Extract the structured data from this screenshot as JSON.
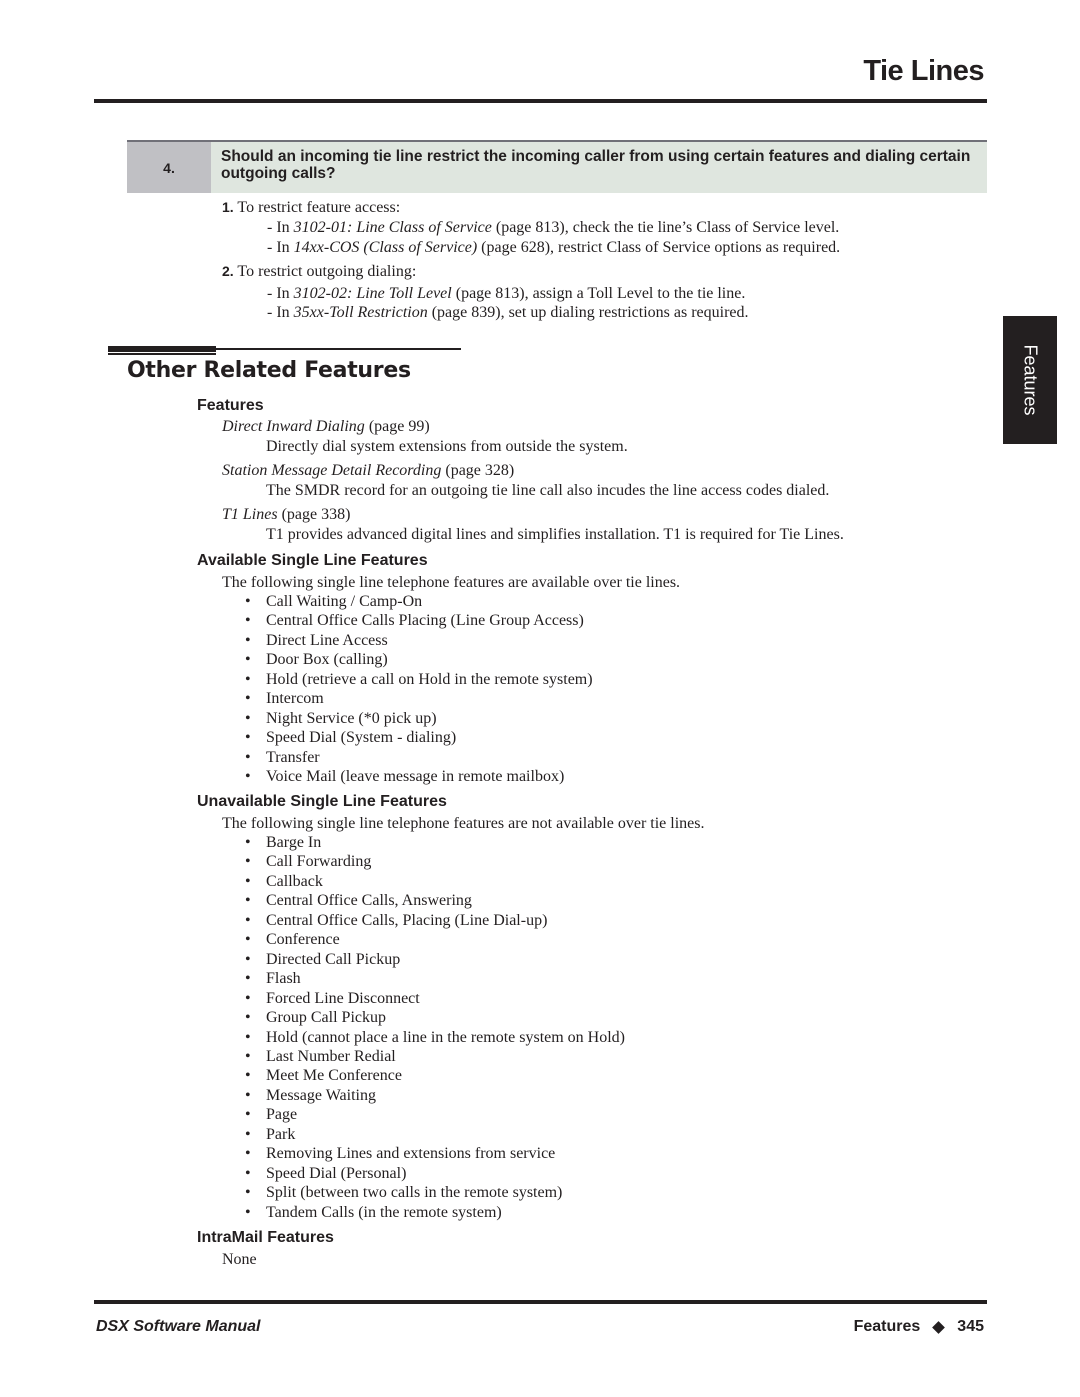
{
  "header": {
    "title": "Tie Lines"
  },
  "side_tab": {
    "label": "Features"
  },
  "question": {
    "number": "4.",
    "text": "Should an incoming tie line restrict the incoming caller from using certain features and dialing certain outgoing calls?"
  },
  "steps": [
    {
      "number": "1.",
      "text": "To restrict feature access:",
      "items": [
        {
          "prefix": "In ",
          "link": "3102-01: Line Class of Service",
          "suffix": " (page 813), check the tie line’s Class of Service level."
        },
        {
          "prefix": "In ",
          "link": "14xx-COS (Class of Service)",
          "suffix": " (page 628), restrict Class of Service options as required."
        }
      ]
    },
    {
      "number": "2.",
      "text": "To restrict outgoing dialing:",
      "items": [
        {
          "prefix": "In ",
          "link": "3102-02: Line Toll Level",
          "suffix": " (page 813), assign a Toll Level to the tie line."
        },
        {
          "prefix": "In ",
          "link": "35xx-Toll Restriction",
          "suffix": " (page 839), set up dialing restrictions as required."
        }
      ]
    }
  ],
  "related": {
    "title": "Other Related Features",
    "features_heading": "Features",
    "features": [
      {
        "link": "Direct Inward Dialing",
        "page": " (page 99)",
        "desc": "Directly dial system extensions from outside the system."
      },
      {
        "link": "Station Message Detail Recording",
        "page": " (page 328)",
        "desc": "The SMDR record for an outgoing tie line call also incudes the line access codes dialed."
      },
      {
        "link": "T1 Lines",
        "page": " (page 338)",
        "desc": "T1 provides advanced digital lines and simplifies installation. T1 is required for Tie Lines."
      }
    ],
    "available": {
      "heading": "Available Single Line Features",
      "intro": "The following single line telephone features are available over tie lines.",
      "items": [
        "Call Waiting / Camp-On",
        "Central Office Calls Placing (Line Group Access)",
        "Direct Line Access",
        "Door Box (calling)",
        "Hold (retrieve a call on Hold in the remote system)",
        "Intercom",
        "Night Service (*0 pick up)",
        "Speed Dial (System - dialing)",
        "Transfer",
        "Voice Mail (leave message in remote mailbox)"
      ]
    },
    "unavailable": {
      "heading": "Unavailable Single Line Features",
      "intro": "The following single line telephone features are not available over tie lines.",
      "items": [
        "Barge In",
        "Call Forwarding",
        "Callback",
        "Central Office Calls, Answering",
        "Central Office Calls, Placing (Line Dial-up)",
        "Conference",
        "Directed Call Pickup",
        "Flash",
        "Forced Line Disconnect",
        "Group Call Pickup",
        "Hold (cannot place a line in the remote system on Hold)",
        "Last Number Redial",
        "Meet Me Conference",
        "Message Waiting",
        "Page",
        "Park",
        "Removing Lines and extensions from service",
        "Speed Dial (Personal)",
        "Split (between two calls in the remote system)",
        "Tandem Calls (in the remote system)"
      ]
    },
    "intramail": {
      "heading": "IntraMail Features",
      "text": "None"
    }
  },
  "footer": {
    "manual": "DSX Software Manual",
    "section": "Features",
    "page": "345"
  }
}
